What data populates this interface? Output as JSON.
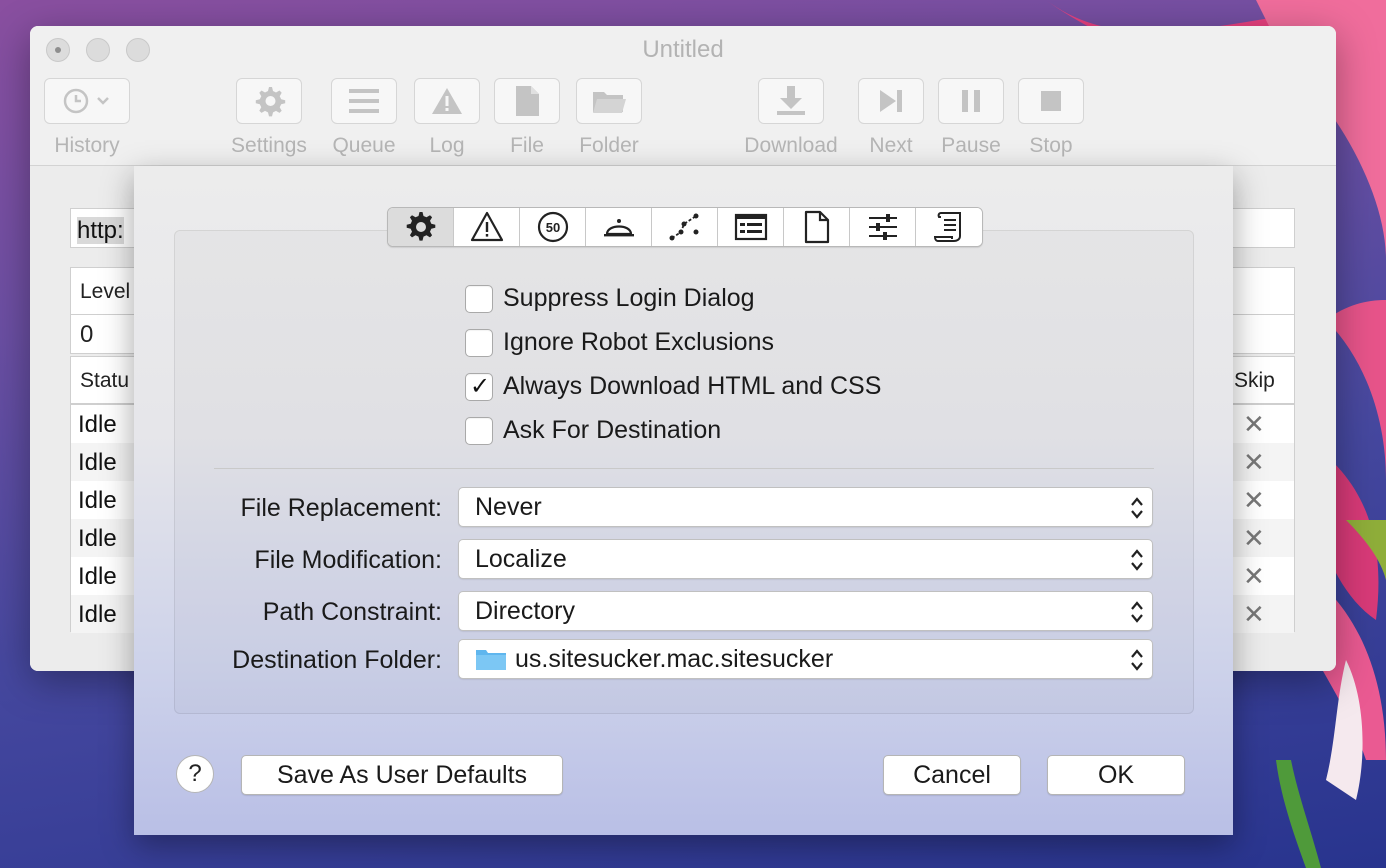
{
  "window": {
    "title": "Untitled",
    "toolbar": {
      "history": "History",
      "settings": "Settings",
      "queue": "Queue",
      "log": "Log",
      "file": "File",
      "folder": "Folder",
      "download": "Download",
      "next": "Next",
      "pause": "Pause",
      "stop": "Stop"
    },
    "url_prefix": "http:",
    "level_header": "Level",
    "level_value": "0",
    "status_header": "Statu",
    "skip_header": "Skip",
    "rows": [
      "Idle",
      "Idle",
      "Idle",
      "Idle",
      "Idle",
      "Idle"
    ],
    "skip_glyph": "✕"
  },
  "sheet": {
    "tabs": [
      "gear-icon",
      "warning-icon",
      "limit-50-icon",
      "bell-icon",
      "network-icon",
      "form-icon",
      "file-icon",
      "sliders-icon",
      "script-icon"
    ],
    "limit_tab_text": "50",
    "checkboxes": {
      "suppress_login": {
        "label": "Suppress Login Dialog",
        "checked": false
      },
      "ignore_robot": {
        "label": "Ignore Robot Exclusions",
        "checked": false
      },
      "always_download": {
        "label": "Always Download HTML and CSS",
        "checked": true
      },
      "ask_destination": {
        "label": "Ask For Destination",
        "checked": false
      }
    },
    "file_replacement": {
      "label": "File Replacement:",
      "value": "Never"
    },
    "file_modification": {
      "label": "File Modification:",
      "value": "Localize"
    },
    "path_constraint": {
      "label": "Path Constraint:",
      "value": "Directory"
    },
    "destination_folder": {
      "label": "Destination Folder:",
      "value": "us.sitesucker.mac.sitesucker"
    },
    "help": "?",
    "save_defaults": "Save As User Defaults",
    "cancel": "Cancel",
    "ok": "OK"
  },
  "colors": {
    "folder": "#5fb6ee",
    "flower": "#d23a78"
  }
}
